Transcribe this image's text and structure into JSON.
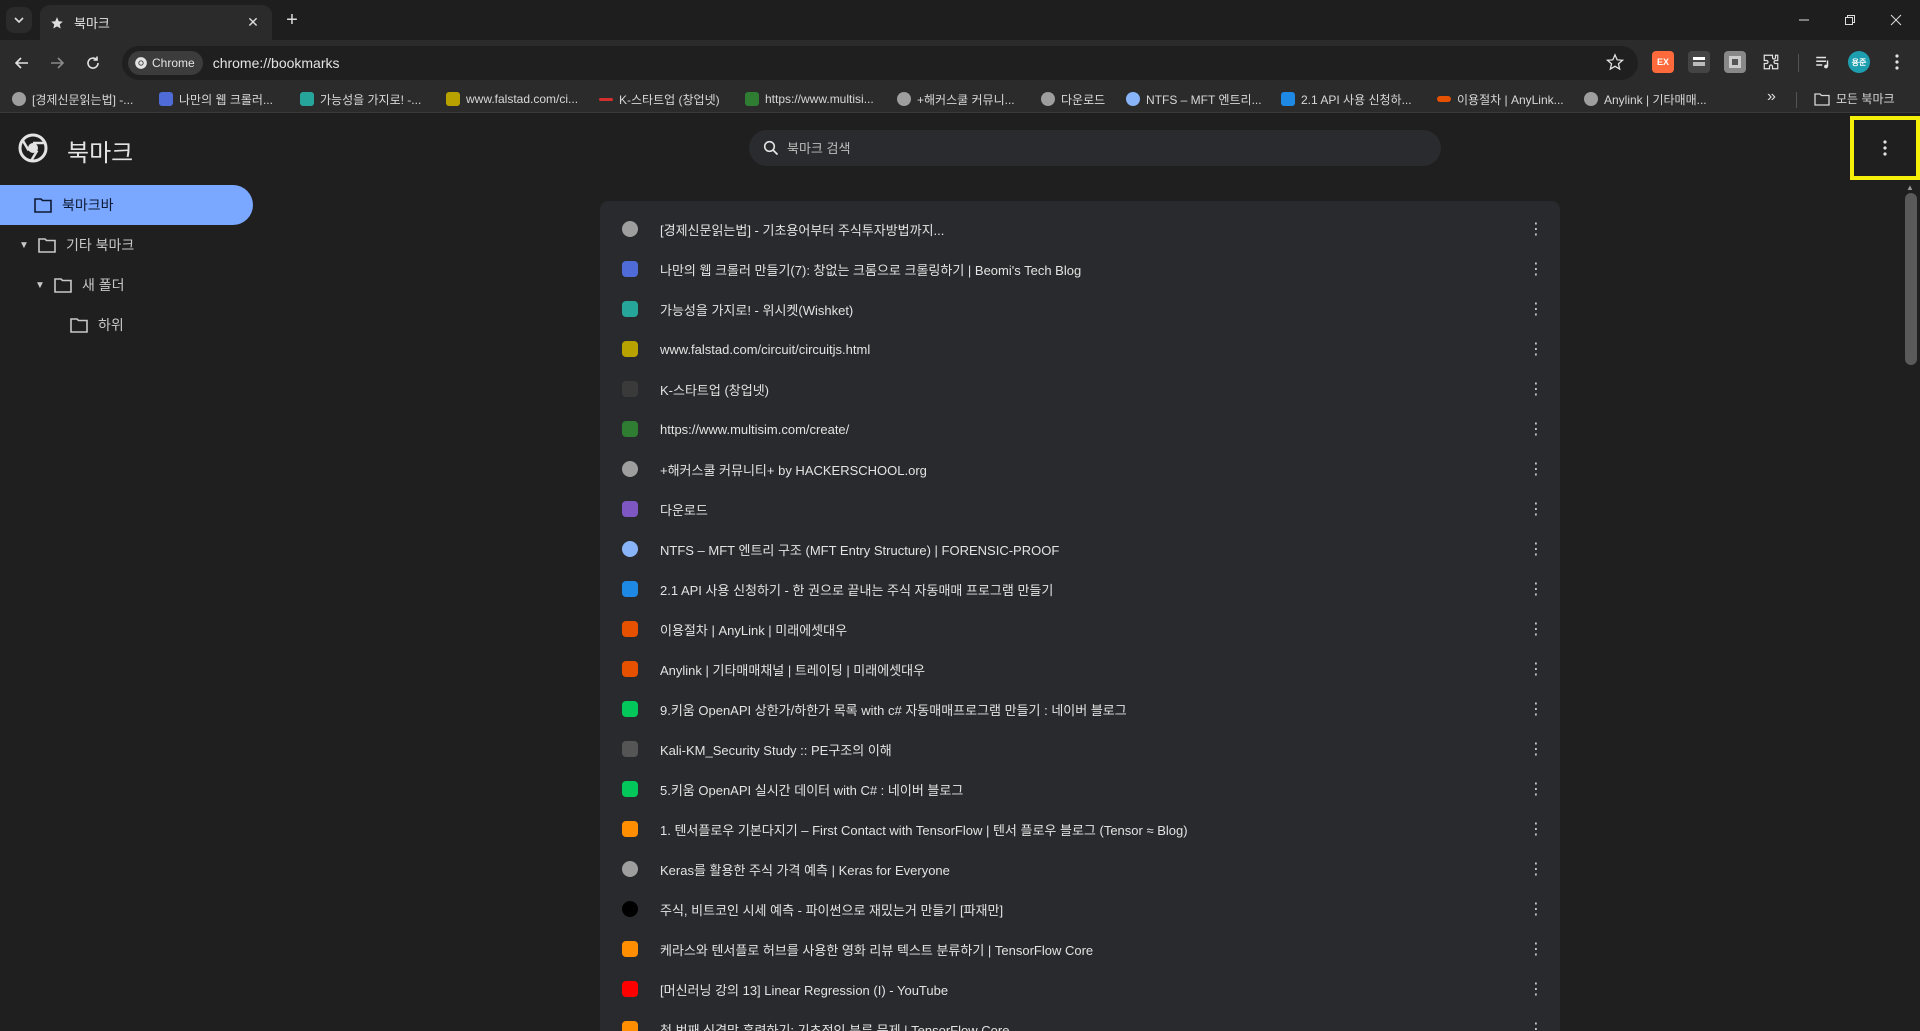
{
  "tab": {
    "title": "북마크"
  },
  "toolbar": {
    "chip_label": "Chrome",
    "url": "chrome://bookmarks",
    "profile_initials": "용준",
    "extensions": [
      {
        "name": "ext-red",
        "color": "#ff6a3d",
        "label": "EX"
      },
      {
        "name": "ext-dark",
        "color": "#444444",
        "label": ""
      },
      {
        "name": "ext-gray",
        "color": "#777777",
        "label": ""
      }
    ]
  },
  "bookmarks_bar": {
    "items": [
      {
        "label": "[경제신문읽는법] -...",
        "color": "#9e9e9e"
      },
      {
        "label": "나만의 웹 크롤러...",
        "color": "#4f6bd8"
      },
      {
        "label": "가능성을 가지로! -...",
        "color": "#26a69a"
      },
      {
        "label": "www.falstad.com/ci...",
        "color": "#b8a200"
      },
      {
        "label": "K-스타트업 (창업넷)",
        "color": "#d32f2f"
      },
      {
        "label": "https://www.multisi...",
        "color": "#2e7d32"
      },
      {
        "label": "+해커스쿨 커뮤니...",
        "color": "#9e9e9e"
      },
      {
        "label": "다운로드",
        "color": "#9e9e9e"
      },
      {
        "label": "NTFS – MFT 엔트리...",
        "color": "#8ab4f8"
      },
      {
        "label": "2.1 API 사용 신청하...",
        "color": "#1e88e5"
      },
      {
        "label": "이용절차 | AnyLink...",
        "color": "#e65100"
      },
      {
        "label": "Anylink | 기타매매...",
        "color": "#9e9e9e"
      }
    ],
    "all_bookmarks_label": "모든 북마크"
  },
  "page": {
    "title": "북마크",
    "search_placeholder": "북마크 검색"
  },
  "sidebar": {
    "folders": [
      {
        "label": "북마크바",
        "selected": true
      },
      {
        "label": "기타 북마크",
        "selected": false
      },
      {
        "label": "새 폴더",
        "selected": false
      },
      {
        "label": "하위",
        "selected": false
      }
    ]
  },
  "list": {
    "items": [
      {
        "title": "[경제신문읽는법] - 기초용어부터 주식투자방법까지...",
        "favicon_color": "#9e9e9e",
        "favicon": "globe-icon"
      },
      {
        "title": "나만의 웹 크롤러 만들기(7): 창없는 크롬으로 크롤링하기 | Beomi's Tech Blog",
        "favicon_color": "#4f6bd8",
        "favicon": "layers-icon"
      },
      {
        "title": "가능성을 가지로! - 위시켓(Wishket)",
        "favicon_color": "#26a69a",
        "favicon": "wishket-icon"
      },
      {
        "title": "www.falstad.com/circuit/circuitjs.html",
        "favicon_color": "#b8a200",
        "favicon": "circuit-icon"
      },
      {
        "title": "K-스타트업 (창업넷)",
        "favicon_color": "#3a3a3a",
        "favicon": "kstartup-icon"
      },
      {
        "title": "https://www.multisim.com/create/",
        "favicon_color": "#2e7d32",
        "favicon": "multisim-icon"
      },
      {
        "title": "+해커스쿨 커뮤니티+ by HACKERSCHOOL.org",
        "favicon_color": "#9e9e9e",
        "favicon": "globe-icon"
      },
      {
        "title": "다운로드",
        "favicon_color": "#7e57c2",
        "favicon": "download-icon"
      },
      {
        "title": "NTFS – MFT 엔트리 구조 (MFT Entry Structure) | FORENSIC-PROOF",
        "favicon_color": "#8ab4f8",
        "favicon": "magnifier-icon"
      },
      {
        "title": "2.1 API 사용 신청하기 - 한 권으로 끝내는 주식 자동매매 프로그램 만들기",
        "favicon_color": "#1e88e5",
        "favicon": "wikidocs-icon"
      },
      {
        "title": "이용절차 | AnyLink | 미래에셋대우",
        "favicon_color": "#e65100",
        "favicon": "anylink-icon"
      },
      {
        "title": "Anylink | 기타매매채널 | 트레이딩 | 미래에셋대우",
        "favicon_color": "#e65100",
        "favicon": "anylink-icon"
      },
      {
        "title": "9.키움 OpenAPI 상한가/하한가 목록 with c# 자동매매프로그램 만들기 : 네이버 블로그",
        "favicon_color": "#03c75a",
        "favicon": "naver-blog-icon"
      },
      {
        "title": "Kali-KM_Security Study :: PE구조의 이해",
        "favicon_color": "#555555",
        "favicon": "tistory-icon"
      },
      {
        "title": "5.키움 OpenAPI 실시간 데이터 with C# : 네이버 블로그",
        "favicon_color": "#03c75a",
        "favicon": "naver-blog-icon"
      },
      {
        "title": "1. 텐서플로우 기본다지기 – First Contact with TensorFlow | 텐서 플로우 블로그 (Tensor ≈ Blog)",
        "favicon_color": "#ff8f00",
        "favicon": "cube-icon"
      },
      {
        "title": "Keras를 활용한 주식 가격 예측 | Keras for Everyone",
        "favicon_color": "#9e9e9e",
        "favicon": "globe-icon"
      },
      {
        "title": "주식, 비트코인 시세 예측 - 파이썬으로 재밌는거 만들기 [파재만]",
        "favicon_color": "#000000",
        "favicon": "circle-icon"
      },
      {
        "title": "케라스와 텐서플로 허브를 사용한 영화 리뷰 텍스트 분류하기  |  TensorFlow Core",
        "favicon_color": "#ff8f00",
        "favicon": "tensorflow-icon"
      },
      {
        "title": "[머신러닝 강의 13] Linear Regression (I) - YouTube",
        "favicon_color": "#ff0000",
        "favicon": "youtube-icon"
      },
      {
        "title": "첫 번째 신경망 훈련하기: 기초적인 분류 문제  |  TensorFlow Core",
        "favicon_color": "#ff8f00",
        "favicon": "tensorflow-icon"
      }
    ]
  }
}
